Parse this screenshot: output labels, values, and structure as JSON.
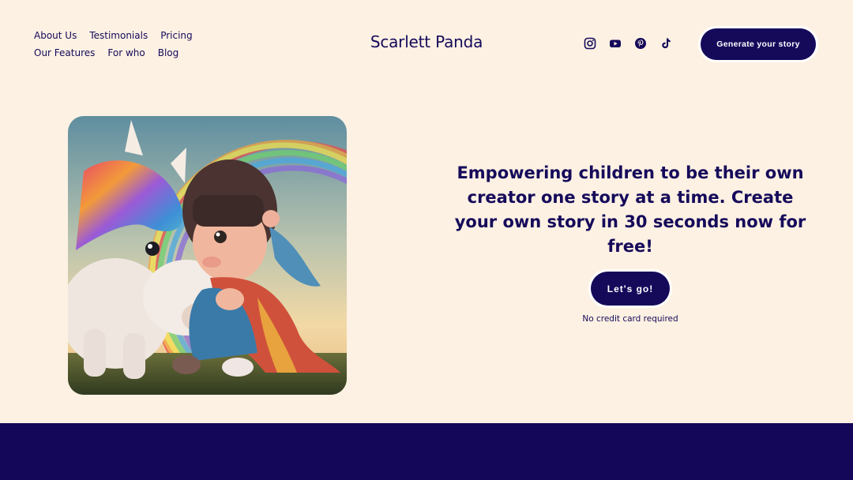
{
  "header": {
    "nav": [
      {
        "label": "About Us"
      },
      {
        "label": "Testimonials"
      },
      {
        "label": "Pricing"
      },
      {
        "label": "Our Features"
      },
      {
        "label": "For who"
      },
      {
        "label": "Blog"
      }
    ],
    "brand": "Scarlett Panda",
    "socials": [
      "instagram-icon",
      "youtube-icon",
      "pinterest-icon",
      "tiktok-icon"
    ],
    "cta_label": "Generate your story"
  },
  "hero": {
    "headline": "Empowering children to be their own creator one story at a time. Create your own story in 30 seconds now for free!",
    "button_label": "Let's go!",
    "note": "No credit card required"
  },
  "colors": {
    "background": "#fdf1e3",
    "primary": "#150a5a",
    "band": "#14075a"
  }
}
